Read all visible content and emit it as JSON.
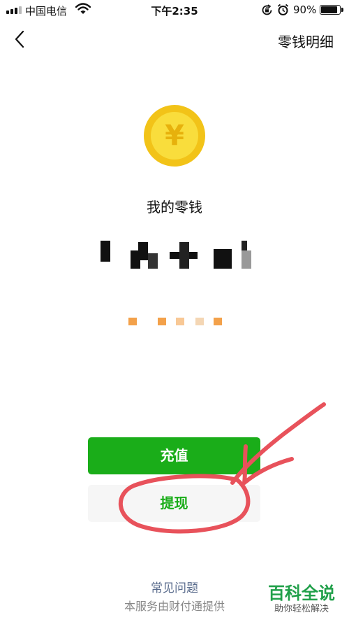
{
  "status_bar": {
    "carrier": "中国电信",
    "time": "下午2:35",
    "battery_percent": "90%",
    "battery_level": 0.9,
    "signal_bars_filled": 3,
    "icons": [
      "signal-icon",
      "wifi-icon",
      "rotation-lock-icon",
      "alarm-icon",
      "battery-icon"
    ]
  },
  "nav": {
    "back_icon": "chevron-left-icon",
    "title": "零钱明细"
  },
  "balance": {
    "coin_icon": "yen-coin-icon",
    "coin_symbol": "¥",
    "label": "我的零钱"
  },
  "actions": {
    "recharge_label": "充值",
    "withdraw_label": "提现"
  },
  "footer": {
    "faq_label": "常见问题",
    "provider_text": "本服务由财付通提供"
  },
  "watermark": {
    "title": "百科全说",
    "subtitle": "助你轻松解决"
  },
  "colors": {
    "primary_green": "#1aad19",
    "coin_yellow": "#f2c318",
    "annotation_red": "#e8525b",
    "link_blue": "#596b8c"
  }
}
